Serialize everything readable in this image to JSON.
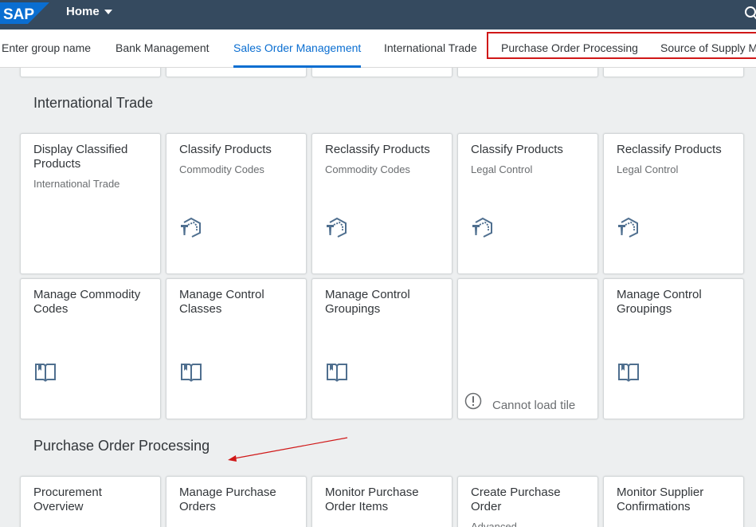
{
  "shell": {
    "logo_text": "SAP",
    "home_label": "Home",
    "brand_color": "#354a5f",
    "logo_color": "#0a6ed1"
  },
  "anchor_bar": {
    "items": [
      {
        "label": "Enter group name",
        "selected": false
      },
      {
        "label": "Bank Management",
        "selected": false
      },
      {
        "label": "Sales Order Management",
        "selected": true
      },
      {
        "label": "International Trade",
        "selected": false
      },
      {
        "label": "Purchase Order Processing",
        "selected": false
      },
      {
        "label": "Source of Supply M",
        "selected": false
      }
    ],
    "highlight_color": "#d01818"
  },
  "groups": {
    "international_trade": {
      "title": "International Trade",
      "tiles": [
        {
          "title": "Display Classified Products",
          "subtitle": "International Trade",
          "icon": "none"
        },
        {
          "title": "Classify Products",
          "subtitle": "Commodity Codes",
          "icon": "classify-icon"
        },
        {
          "title": "Reclassify Products",
          "subtitle": "Commodity Codes",
          "icon": "classify-icon"
        },
        {
          "title": "Classify Products",
          "subtitle": "Legal Control",
          "icon": "classify-icon"
        },
        {
          "title": "Reclassify Products",
          "subtitle": "Legal Control",
          "icon": "classify-icon"
        },
        {
          "title": "Manage Commodity Codes",
          "subtitle": "",
          "icon": "book-icon"
        },
        {
          "title": "Manage Control Classes",
          "subtitle": "",
          "icon": "book-icon"
        },
        {
          "title": "Manage Control Groupings",
          "subtitle": "",
          "icon": "book-icon"
        },
        {
          "error": "Cannot load tile",
          "icon": "alert-icon"
        },
        {
          "title": "Manage Control Groupings",
          "subtitle": "",
          "icon": "book-icon"
        }
      ]
    },
    "purchase_order_processing": {
      "title": "Purchase Order Processing",
      "tiles": [
        {
          "title": "Procurement Overview"
        },
        {
          "title": "Manage Purchase Orders"
        },
        {
          "title": "Monitor Purchase Order Items"
        },
        {
          "title": "Create Purchase Order",
          "subtitle": "Advanced"
        },
        {
          "title": "Monitor Supplier Confirmations"
        }
      ]
    }
  },
  "annotation_color": "#d01818"
}
